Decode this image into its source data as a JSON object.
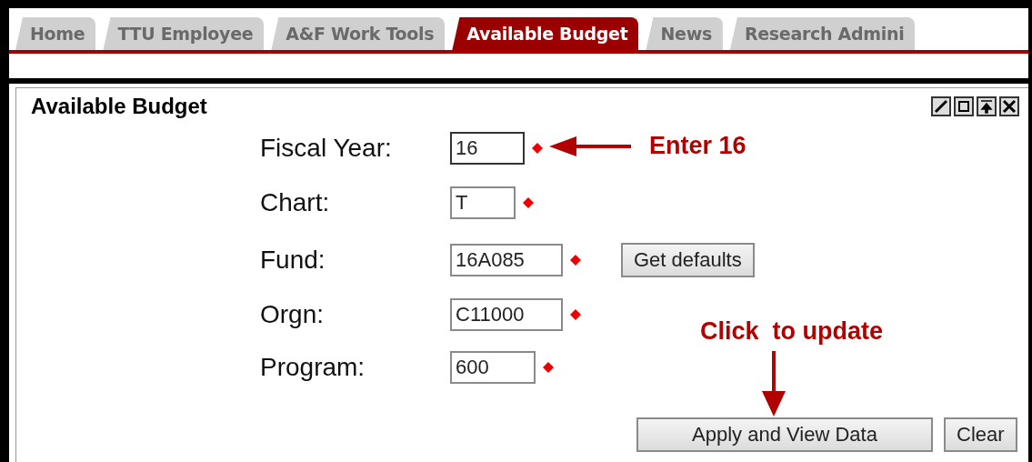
{
  "tabs": [
    {
      "label": "Home",
      "selected": false
    },
    {
      "label": "TTU Employee",
      "selected": false
    },
    {
      "label": "A&F Work Tools",
      "selected": false
    },
    {
      "label": "Available Budget",
      "selected": true
    },
    {
      "label": "News",
      "selected": false
    },
    {
      "label": "Research Admini",
      "selected": false
    }
  ],
  "portlet": {
    "title": "Available Budget"
  },
  "fields": [
    {
      "label": "Fiscal Year:",
      "value": "16",
      "focused": true
    },
    {
      "label": "Chart:",
      "value": "T",
      "focused": false
    },
    {
      "label": "Fund:",
      "value": "16A085",
      "focused": false
    },
    {
      "label": "Orgn:",
      "value": "C11000",
      "focused": false
    },
    {
      "label": "Program:",
      "value": "600",
      "focused": false
    }
  ],
  "get_defaults_button": "Get defaults",
  "buttons": [
    "Apply and View Data",
    "Clear"
  ],
  "annotations": [
    {
      "text": "Enter 16",
      "kind": "left"
    },
    {
      "text": "Click  to update",
      "kind": "down"
    }
  ]
}
